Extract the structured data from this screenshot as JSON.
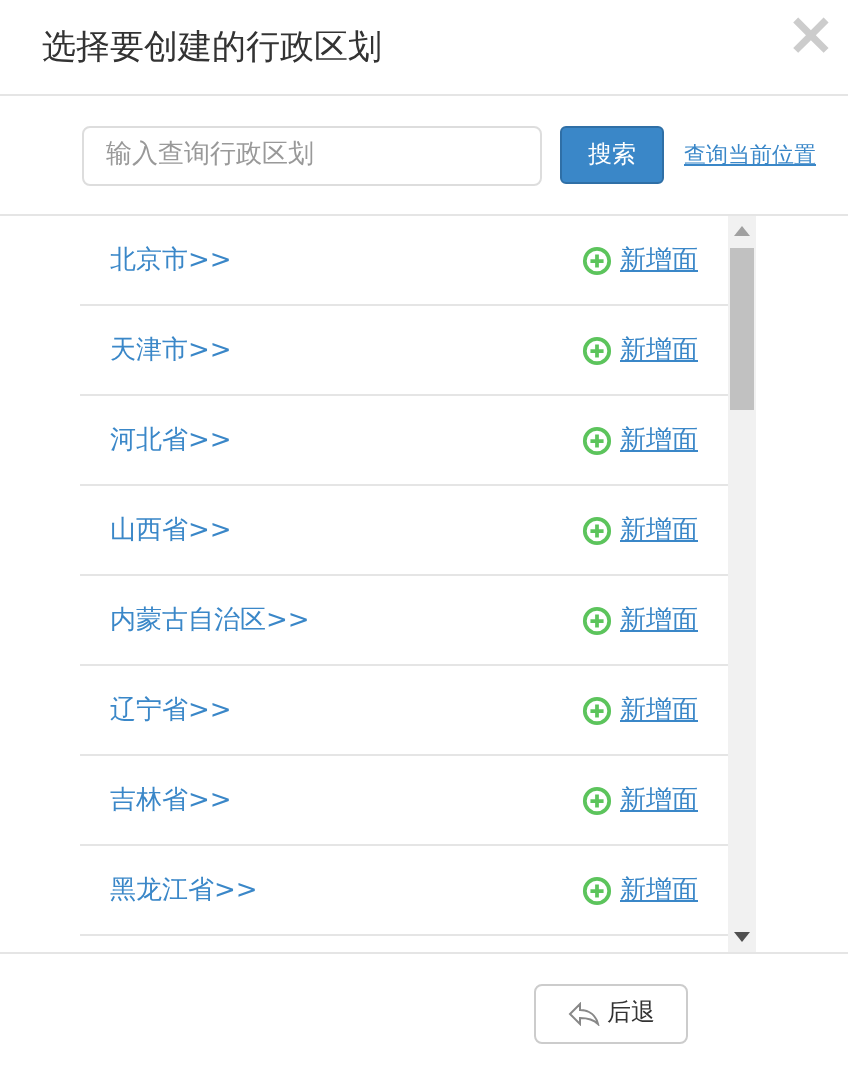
{
  "dialog": {
    "title": "选择要创建的行政区划",
    "close": "×"
  },
  "search": {
    "placeholder": "输入查询行政区划",
    "button": "搜索",
    "locate_link": "查询当前位置"
  },
  "regions": [
    {
      "name": "北京市>>",
      "action": "新增面"
    },
    {
      "name": "天津市>>",
      "action": "新增面"
    },
    {
      "name": "河北省>>",
      "action": "新增面"
    },
    {
      "name": "山西省>>",
      "action": "新增面"
    },
    {
      "name": "内蒙古自治区>>",
      "action": "新增面"
    },
    {
      "name": "辽宁省>>",
      "action": "新增面"
    },
    {
      "name": "吉林省>>",
      "action": "新增面"
    },
    {
      "name": "黑龙江省>>",
      "action": "新增面"
    }
  ],
  "footer": {
    "back_button": "后退"
  }
}
